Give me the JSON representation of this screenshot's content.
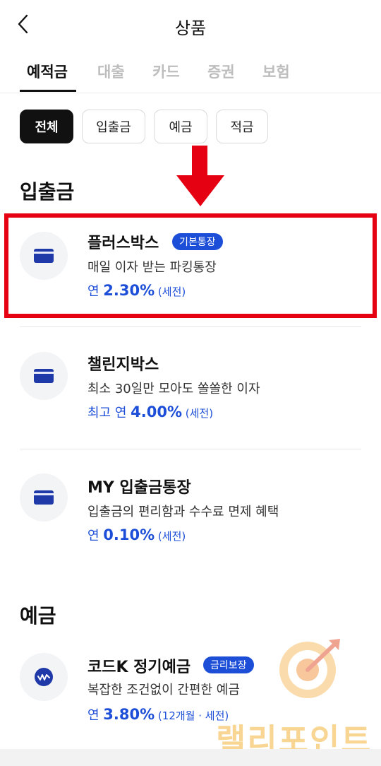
{
  "header": {
    "title": "상품"
  },
  "tabs": [
    {
      "label": "예적금",
      "active": true
    },
    {
      "label": "대출",
      "active": false
    },
    {
      "label": "카드",
      "active": false
    },
    {
      "label": "증권",
      "active": false
    },
    {
      "label": "보험",
      "active": false
    }
  ],
  "filters": [
    {
      "label": "전체",
      "active": true
    },
    {
      "label": "입출금",
      "active": false
    },
    {
      "label": "예금",
      "active": false
    },
    {
      "label": "적금",
      "active": false
    }
  ],
  "sections": {
    "deposit_withdraw": {
      "title": "입출금"
    },
    "savings": {
      "title": "예금"
    }
  },
  "products": [
    {
      "name": "플러스박스",
      "badge": "기본통장",
      "desc": "매일 이자 받는 파킹통장",
      "rate_prefix": "연 ",
      "rate": "2.30%",
      "rate_suffix": " (세전)",
      "icon": "card-icon"
    },
    {
      "name": "챌린지박스",
      "desc": "최소 30일만 모아도 쏠쏠한 이자",
      "rate_prefix": "최고 연 ",
      "rate": "4.00%",
      "rate_suffix": " (세전)",
      "icon": "card-icon"
    },
    {
      "name": "MY 입출금통장",
      "desc": "입출금의 편리함과 수수료 면제 혜택",
      "rate_prefix": "연 ",
      "rate": "0.10%",
      "rate_suffix": " (세전)",
      "icon": "card-icon"
    },
    {
      "name": "코드K 정기예금",
      "badge": "금리보장",
      "desc": "복잡한 조건없이 간편한 예금",
      "rate_prefix": "연 ",
      "rate": "3.80%",
      "rate_suffix": " (12개월 · 세전)",
      "icon": "won-coin-icon"
    }
  ],
  "watermark": {
    "text": "랠리포인트"
  },
  "colors": {
    "accent": "#1d4ed8",
    "highlight": "#e50012",
    "chip_active": "#111111",
    "icon_bg": "#f3f4f6"
  }
}
